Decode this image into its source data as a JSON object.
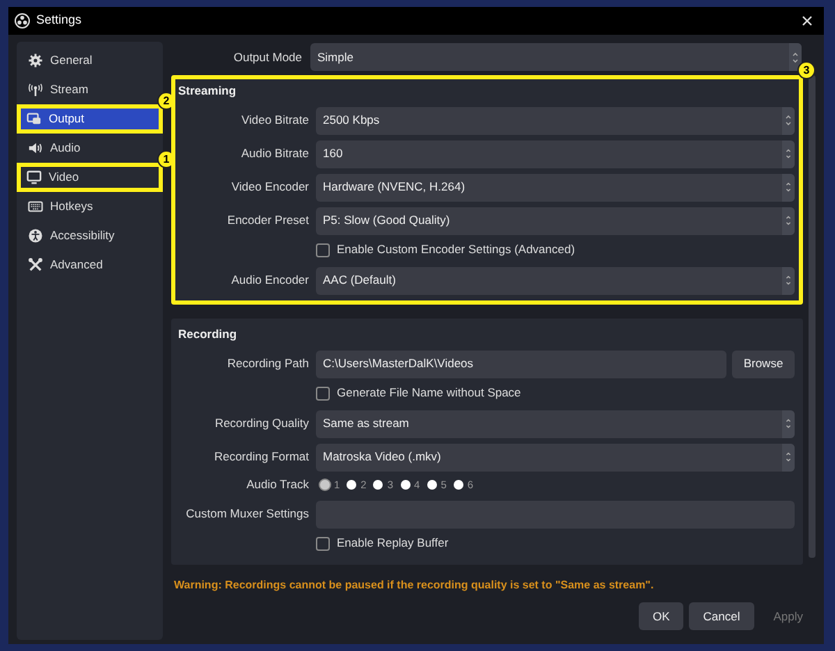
{
  "window": {
    "title": "Settings"
  },
  "sidebar": {
    "items": [
      {
        "label": "General",
        "selected": false
      },
      {
        "label": "Stream",
        "selected": false
      },
      {
        "label": "Output",
        "selected": true,
        "callout": "2"
      },
      {
        "label": "Audio",
        "selected": false
      },
      {
        "label": "Video",
        "selected": false,
        "callout": "1"
      },
      {
        "label": "Hotkeys",
        "selected": false
      },
      {
        "label": "Accessibility",
        "selected": false
      },
      {
        "label": "Advanced",
        "selected": false
      }
    ]
  },
  "output_mode": {
    "label": "Output Mode",
    "value": "Simple"
  },
  "streaming": {
    "title": "Streaming",
    "callout": "3",
    "rows": [
      {
        "kind": "spin",
        "label": "Video Bitrate",
        "value": "2500 Kbps"
      },
      {
        "kind": "select",
        "label": "Audio Bitrate",
        "value": "160"
      },
      {
        "kind": "select",
        "label": "Video Encoder",
        "value": "Hardware (NVENC, H.264)"
      },
      {
        "kind": "select",
        "label": "Encoder Preset",
        "value": "P5: Slow (Good Quality)"
      },
      {
        "kind": "checkbox",
        "label": "Enable Custom Encoder Settings (Advanced)",
        "checked": false
      },
      {
        "kind": "select",
        "label": "Audio Encoder",
        "value": "AAC (Default)"
      }
    ]
  },
  "recording": {
    "title": "Recording",
    "rows": [
      {
        "kind": "path",
        "label": "Recording Path",
        "value": "C:\\Users\\MasterDalK\\Videos",
        "button": "Browse"
      },
      {
        "kind": "checkbox",
        "label": "Generate File Name without Space",
        "checked": false
      },
      {
        "kind": "select",
        "label": "Recording Quality",
        "value": "Same as stream"
      },
      {
        "kind": "select",
        "label": "Recording Format",
        "value": "Matroska Video (.mkv)"
      },
      {
        "kind": "radios",
        "label": "Audio Track",
        "options": [
          {
            "label": "1",
            "selected": true
          },
          {
            "label": "2",
            "selected": false
          },
          {
            "label": "3",
            "selected": false
          },
          {
            "label": "4",
            "selected": false
          },
          {
            "label": "5",
            "selected": false
          },
          {
            "label": "6",
            "selected": false
          }
        ]
      },
      {
        "kind": "input",
        "label": "Custom Muxer Settings"
      },
      {
        "kind": "checkbox",
        "label": "Enable Replay Buffer",
        "checked": false
      }
    ]
  },
  "warning": "Warning: Recordings cannot be paused if the recording quality is set to \"Same as stream\".",
  "buttons": [
    {
      "label": "OK",
      "disabled": false
    },
    {
      "label": "Cancel",
      "disabled": false
    },
    {
      "label": "Apply",
      "disabled": true
    }
  ]
}
